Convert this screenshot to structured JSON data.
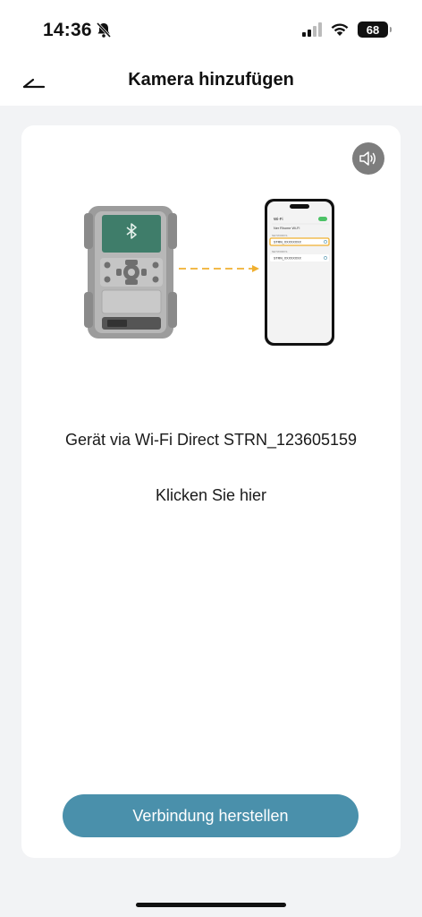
{
  "status_bar": {
    "time": "14:36",
    "battery": "68",
    "icons": [
      "bell-slash-icon",
      "cellular-signal-icon",
      "wifi-icon",
      "battery-icon"
    ]
  },
  "nav": {
    "title": "Kamera hinzufügen",
    "back_icon": "back-arrow-icon"
  },
  "card": {
    "sound_icon": "speaker-icon",
    "illustration": {
      "phone_wifi_label": "Wi-Fi",
      "phone_network_row_1": "Ner Rhome Wi-Fi",
      "phone_section_label": "NETWORKS",
      "phone_highlighted_network": "STRN_XXXXXXXX",
      "phone_other_section_label": "NETWORKS",
      "phone_other_network": "STRN_XXXXXXXX"
    },
    "instruction": "Gerät via Wi-Fi Direct STRN_123605159",
    "click_here": "Klicken Sie hier",
    "connect_button": "Verbindung herstellen"
  },
  "colors": {
    "accent": "#4a90ab",
    "highlight": "#f0b030",
    "screen_green": "#3f7d6a",
    "background": "#f2f3f5"
  }
}
